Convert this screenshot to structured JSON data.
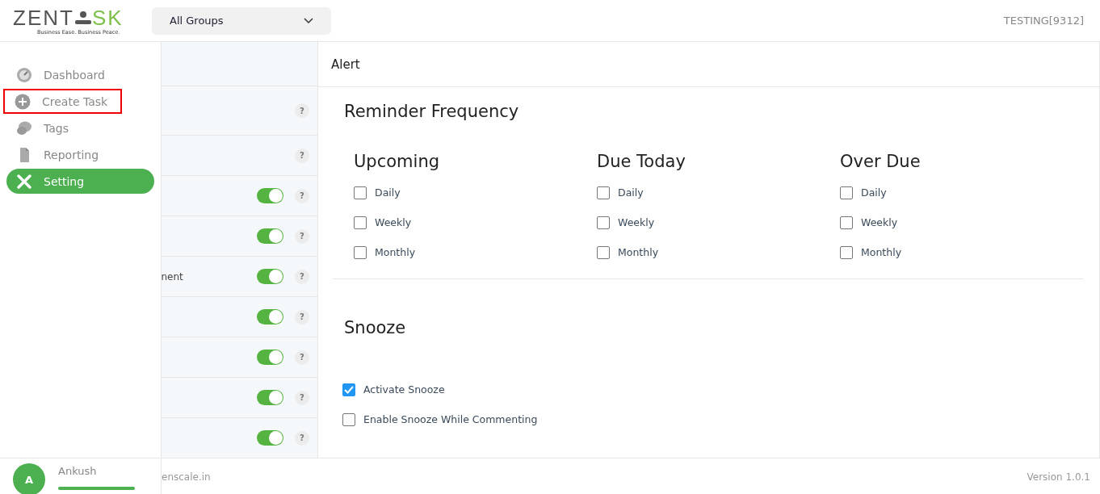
{
  "header": {
    "logo": {
      "text_before": "ZENT",
      "text_after": "SK",
      "tagline": "Business Ease. Business Peace."
    },
    "group_select": {
      "value": "All Groups"
    },
    "account": "TESTING[9312]"
  },
  "sidebar": {
    "items": [
      {
        "label": "Dashboard",
        "selected": false,
        "highlighted": false
      },
      {
        "label": "Create Task",
        "selected": false,
        "highlighted": true
      },
      {
        "label": "Tags",
        "selected": false,
        "highlighted": false
      },
      {
        "label": "Reporting",
        "selected": false,
        "highlighted": false
      },
      {
        "label": "Setting",
        "selected": true,
        "highlighted": false
      }
    ],
    "user": {
      "initial": "A",
      "name": "Ankush",
      "level": 1
    }
  },
  "settings_list": {
    "rows": [
      {
        "label": "",
        "kind": "help",
        "help": "?"
      },
      {
        "label": "",
        "kind": "help",
        "help": "?"
      },
      {
        "label": "",
        "kind": "toggle",
        "on": true,
        "help": "?"
      },
      {
        "label": "",
        "kind": "toggle",
        "on": true,
        "help": "?"
      },
      {
        "label": "nent",
        "kind": "toggle",
        "on": true,
        "help": "?"
      },
      {
        "label": "",
        "kind": "toggle",
        "on": true,
        "help": "?"
      },
      {
        "label": "",
        "kind": "toggle",
        "on": true,
        "help": "?"
      },
      {
        "label": "",
        "kind": "toggle",
        "on": true,
        "help": "?"
      },
      {
        "label": "",
        "kind": "toggle",
        "on": true,
        "help": "?"
      }
    ]
  },
  "panel": {
    "title": "Alert",
    "reminder": {
      "heading": "Reminder Frequency",
      "groups": [
        {
          "title": "Upcoming",
          "options": [
            {
              "label": "Daily",
              "checked": false
            },
            {
              "label": "Weekly",
              "checked": false
            },
            {
              "label": "Monthly",
              "checked": false
            }
          ]
        },
        {
          "title": "Due Today",
          "options": [
            {
              "label": "Daily",
              "checked": false
            },
            {
              "label": "Weekly",
              "checked": false
            },
            {
              "label": "Monthly",
              "checked": false
            }
          ]
        },
        {
          "title": "Over Due",
          "options": [
            {
              "label": "Daily",
              "checked": false
            },
            {
              "label": "Weekly",
              "checked": false
            },
            {
              "label": "Monthly",
              "checked": false
            }
          ]
        }
      ]
    },
    "snooze": {
      "heading": "Snooze",
      "options": [
        {
          "label": "Activate Snooze",
          "checked": true
        },
        {
          "label": "Enable Snooze While Commenting",
          "checked": false
        }
      ]
    }
  },
  "footer": {
    "site": "enscale.in",
    "version": "Version 1.0.1"
  }
}
